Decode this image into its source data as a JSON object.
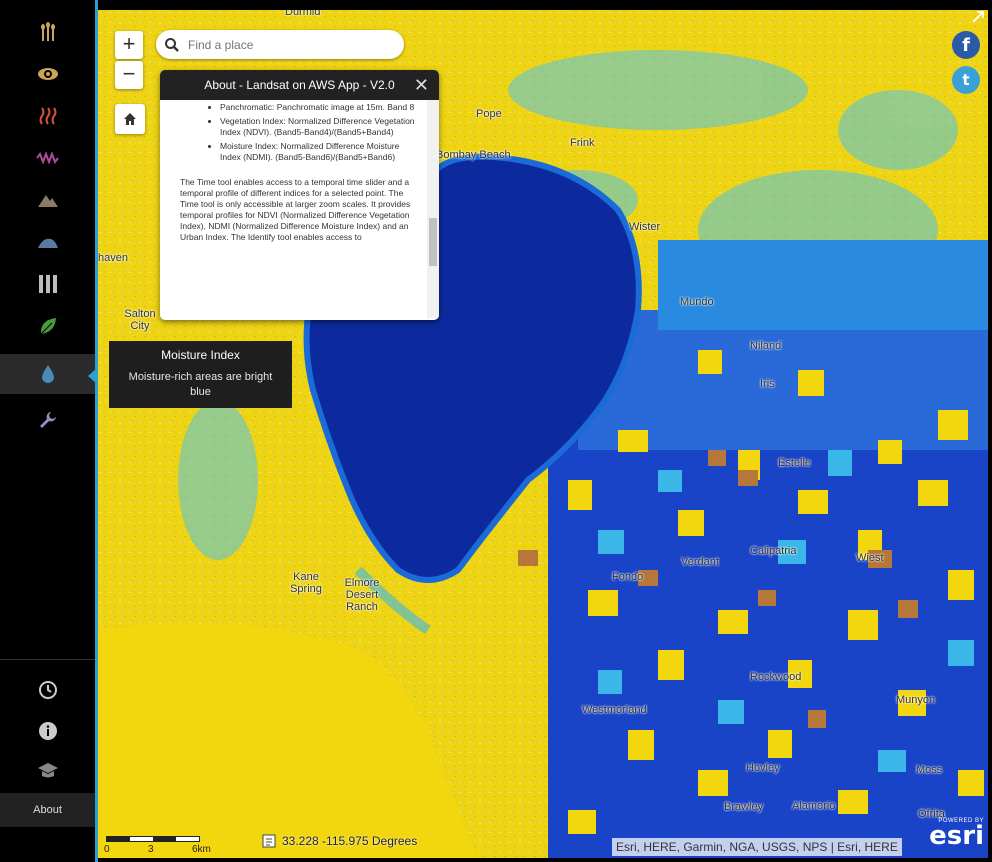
{
  "colors": {
    "accent": "#2a9fd6",
    "dry_yellow": "#f2d60e",
    "water_deep": "#0a2a9a",
    "moist_blue": "#1a4ed8",
    "cyan": "#1fb8e8",
    "brown": "#b5773a",
    "tooltip_bg": "#1e1e1e"
  },
  "sidebar": {
    "items": [
      {
        "name": "agriculture",
        "icon": "wheat-icon"
      },
      {
        "name": "natural-color",
        "icon": "eye-icon"
      },
      {
        "name": "thermal",
        "icon": "heat-waves-icon"
      },
      {
        "name": "color-infrared",
        "icon": "wave-icon"
      },
      {
        "name": "geology",
        "icon": "mountain-icon"
      },
      {
        "name": "bathymetric",
        "icon": "terrain-icon"
      },
      {
        "name": "panchromatic",
        "icon": "bars-icon"
      },
      {
        "name": "vegetation",
        "icon": "leaf-icon"
      },
      {
        "name": "moisture",
        "icon": "water-drop-icon",
        "active": true
      },
      {
        "name": "tools",
        "icon": "wrench-icon"
      }
    ],
    "bottom": [
      {
        "name": "time",
        "icon": "clock-icon"
      },
      {
        "name": "info",
        "icon": "info-icon"
      },
      {
        "name": "education",
        "icon": "graduation-cap-icon"
      }
    ],
    "about_label": "About"
  },
  "tooltip": {
    "title": "Moisture Index",
    "description": "Moisture-rich areas are bright blue"
  },
  "search": {
    "placeholder": "Find a place"
  },
  "zoom": {
    "in_label": "+",
    "out_label": "−"
  },
  "about_panel": {
    "title": "About - Landsat on AWS App - V2.0",
    "close_label": "✕",
    "bullets": [
      "Panchromatic: Panchromatic image at 15m. Band 8",
      "Vegetation Index: Normalized Difference Vegetation Index (NDVI). (Band5-Band4)/(Band5+Band4)",
      "Moisture Index: Normalized Difference Moisture Index (NDMI). (Band5-Band6)/(Band5+Band6)"
    ],
    "paragraph": "The Time tool enables access to a temporal time slider and a temporal profile of different indices for a selected point. The Time tool is only accessible at larger zoom scales. It provides temporal profiles for NDVI (Normalized Difference Vegetation Index), NDMI (Normalized Difference Moisture Index) and an Urban Index. The Identify tool enables access to"
  },
  "places": [
    {
      "key": "durmid",
      "text": "Durmid"
    },
    {
      "key": "pope",
      "text": "Pope"
    },
    {
      "key": "bombay",
      "text": "Bombay Beach"
    },
    {
      "key": "frink",
      "text": "Frink"
    },
    {
      "key": "wister",
      "text": "Wister"
    },
    {
      "key": "haven",
      "text": "haven"
    },
    {
      "key": "salton",
      "text": "Salton City"
    },
    {
      "key": "mundo",
      "text": "Mundo"
    },
    {
      "key": "niland",
      "text": "Niland"
    },
    {
      "key": "iris",
      "text": "Iris"
    },
    {
      "key": "estelle",
      "text": "Estelle"
    },
    {
      "key": "calipatria",
      "text": "Calipatria"
    },
    {
      "key": "wiest",
      "text": "Wiest"
    },
    {
      "key": "kane",
      "text": "Kane Spring"
    },
    {
      "key": "elmore",
      "text": "Elmore Desert Ranch"
    },
    {
      "key": "fondo",
      "text": "Fondo"
    },
    {
      "key": "verdant",
      "text": "Verdant"
    },
    {
      "key": "rockwood",
      "text": "Rockwood"
    },
    {
      "key": "westmorland",
      "text": "Westmorland"
    },
    {
      "key": "munyon",
      "text": "Munyon"
    },
    {
      "key": "hovley",
      "text": "Hovley"
    },
    {
      "key": "moss",
      "text": "Moss"
    },
    {
      "key": "brawley",
      "text": "Brawley"
    },
    {
      "key": "alamorio",
      "text": "Alamorio"
    },
    {
      "key": "ofrita",
      "text": "Ofrita"
    }
  ],
  "scalebar": {
    "ticks": [
      "0",
      "3",
      "6km"
    ]
  },
  "coordinates": {
    "text": "33.228  -115.975 Degrees"
  },
  "attribution": "Esri, HERE, Garmin, NGA, USGS, NPS | Esri, HERE",
  "esri_logo": {
    "powered_by": "POWERED BY",
    "name": "esri"
  },
  "social": {
    "facebook": "f",
    "twitter": "t"
  }
}
